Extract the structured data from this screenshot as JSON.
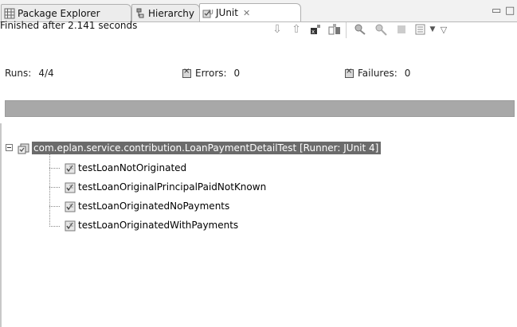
{
  "tabs": [
    {
      "label": "Package Explorer",
      "icon": "package-explorer-icon"
    },
    {
      "label": "Hierarchy",
      "icon": "hierarchy-icon"
    },
    {
      "label": "JUnit",
      "icon": "junit-icon",
      "active": true
    }
  ],
  "status": "Finished after 2.141 seconds",
  "toolbar": {
    "icons": [
      "next-failure-icon",
      "previous-failure-icon",
      "show-failures-only-icon",
      "scroll-lock-icon",
      "rerun-test-icon",
      "rerun-failed-first-icon",
      "stop-icon",
      "test-run-history-icon",
      "view-menu-icon"
    ]
  },
  "counters": {
    "runs_label": "Runs:",
    "runs_value": "4/4",
    "errors_label": "Errors:",
    "errors_value": "0",
    "failures_label": "Failures:",
    "failures_value": "0"
  },
  "progress": {
    "fraction": 1.0,
    "color": "#a8a8a8"
  },
  "tree": {
    "root": "com.eplan.service.contribution.LoanPaymentDetailTest [Runner: JUnit 4]",
    "children": [
      "testLoanNotOriginated",
      "testLoanOriginalPrincipalPaidNotKnown",
      "testLoanOriginatedNoPayments",
      "testLoanOriginatedWithPayments"
    ]
  },
  "colors": {
    "selection": "#6b6b6b",
    "progress": "#a8a8a8"
  }
}
